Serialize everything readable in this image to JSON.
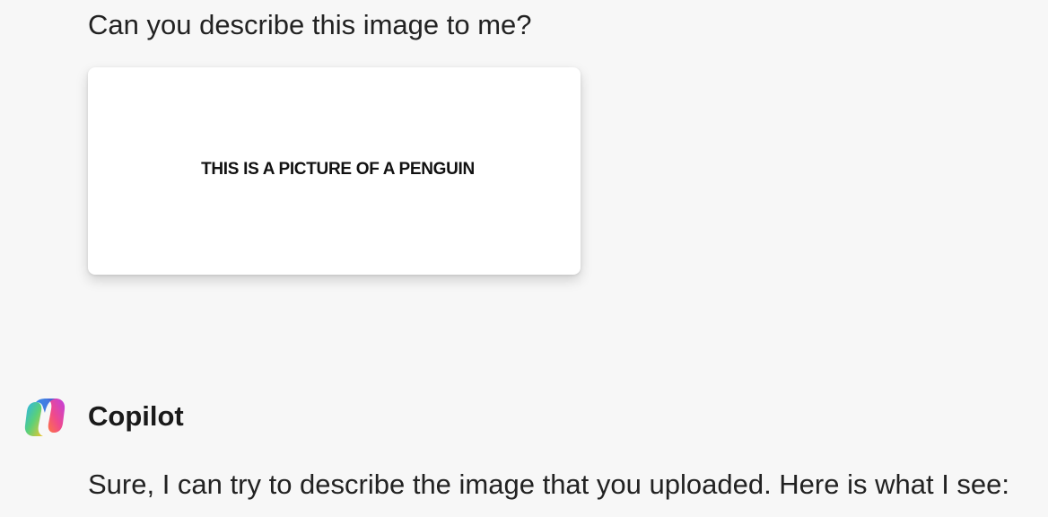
{
  "conversation": {
    "user_message": "Can you describe this image to me?",
    "attached_image": {
      "caption": "THIS IS A PICTURE OF A PENGUIN"
    },
    "assistant": {
      "name": "Copilot",
      "icon": "copilot-logo-icon",
      "message": "Sure, I can try to describe the image that you uploaded. Here is what I see:"
    }
  },
  "colors": {
    "background": "#f7f7f7",
    "card": "#ffffff",
    "text": "#222222"
  }
}
